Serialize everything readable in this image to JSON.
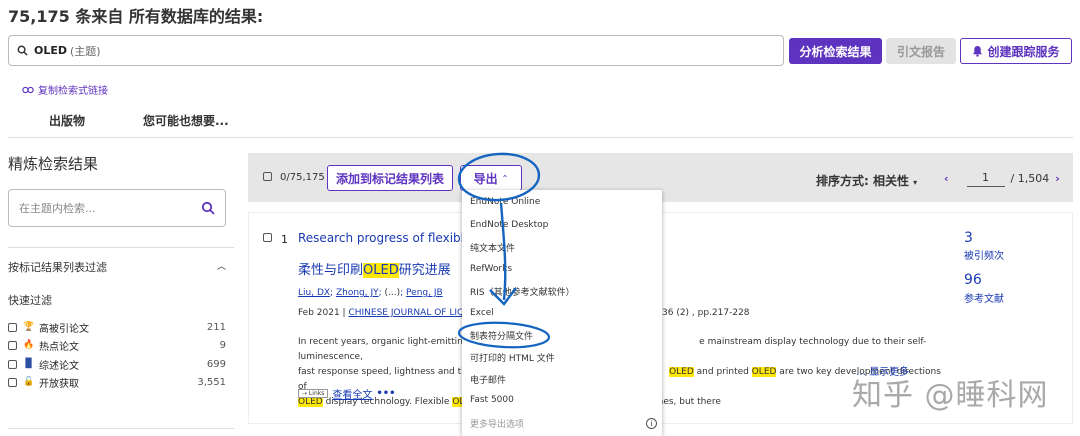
{
  "header": {
    "results_title": "75,175 条来自 所有数据库的结果:"
  },
  "search": {
    "term": "OLED",
    "field": "(主题)"
  },
  "actions": {
    "analyze": "分析检索结果",
    "citation_report": "引文报告",
    "create_alert": "创建跟踪服务"
  },
  "copy_link": "复制检索式链接",
  "tabs": [
    "出版物",
    "您可能也想要..."
  ],
  "sidebar": {
    "refine_title": "精炼检索结果",
    "within_placeholder": "在主题内检索...",
    "filter_by_marked": "按标记结果列表过滤",
    "quick_filters_title": "快速过滤",
    "quick_filters": [
      {
        "label": "高被引论文",
        "count": "211",
        "icon": "trophy-icon",
        "color": "#c0392b"
      },
      {
        "label": "热点论文",
        "count": "9",
        "icon": "flame-icon",
        "color": "#c0392b"
      },
      {
        "label": "综述论文",
        "count": "699",
        "icon": "document-icon",
        "color": "#2c4ea3"
      },
      {
        "label": "开放获取",
        "count": "3,551",
        "icon": "open-lock-icon",
        "color": "#333333"
      }
    ]
  },
  "toolbar": {
    "selected": "0/75,175",
    "add_to_marked": "添加到标记结果列表",
    "export": "导出",
    "sort": "排序方式: 相关性",
    "page": "1",
    "total_pages": "/ 1,504"
  },
  "export_menu": {
    "items": [
      "EndNote Online",
      "EndNote Desktop",
      "纯文本文件",
      "RefWorks",
      "RIS（其他参考文献软件）",
      "Excel",
      "制表符分隔文件",
      "可打印的 HTML 文件",
      "电子邮件",
      "Fast 5000"
    ],
    "more": "更多导出选项"
  },
  "record": {
    "number": "1",
    "title_en": "Research progress of flexible a",
    "title_zh_before": "柔性与印刷",
    "title_zh_highlight": "OLED",
    "title_zh_after": "研究进展",
    "authors": [
      "Liu, DX",
      "Zhong, JY",
      "(...)",
      "Peng, JB"
    ],
    "date": "Feb 2021 |",
    "journal": "CHINESE JOURNAL OF LIQUI",
    "pages": "36 (2) , pp.217-228",
    "abstract": [
      {
        "a": "In recent years, organic light-emitting d",
        "hl": "",
        "b": "e mainstream display technology due to their self-luminescence,"
      },
      {
        "a": "fast response speed, lightness and thin",
        "hl": "OLED",
        "b": " and printed ",
        "hl2": "OLED",
        "c": " are two key development directions of"
      },
      {
        "a": "",
        "hl": "OLED",
        "b": " display technology. Flexible ",
        "hl2": "OLE",
        "c": "ones, but there"
      }
    ],
    "show_more": "显示更多",
    "links_badge": "⇢ Links",
    "full_text": "查看全文",
    "times_cited": "3",
    "times_cited_label": "被引频次",
    "references": "96",
    "references_label": "参考文献"
  },
  "watermark": "知乎 @睡科网"
}
